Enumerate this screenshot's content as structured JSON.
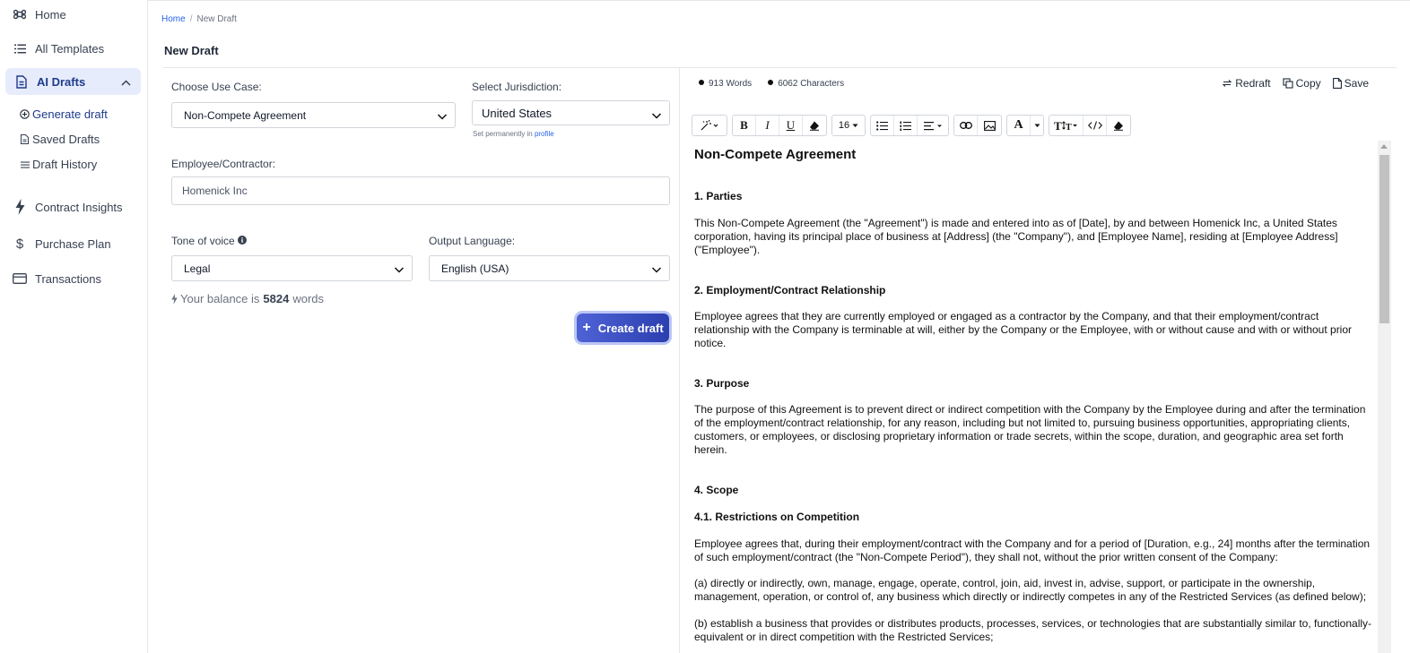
{
  "sidebar": {
    "items": [
      {
        "label": "Home",
        "icon": "command-icon"
      },
      {
        "label": "All Templates",
        "icon": "list-icon"
      },
      {
        "label": "AI Drafts",
        "icon": "document-icon"
      },
      {
        "label": "Contract Insights",
        "icon": "lightning-icon"
      },
      {
        "label": "Purchase Plan",
        "icon": "dollar-icon"
      },
      {
        "label": "Transactions",
        "icon": "card-icon"
      }
    ],
    "sub_items": [
      {
        "label": "Generate draft",
        "icon": "plus-circle-icon"
      },
      {
        "label": "Saved Drafts",
        "icon": "file-icon"
      },
      {
        "label": "Draft History",
        "icon": "lines-icon"
      }
    ]
  },
  "breadcrumb": {
    "home": "Home",
    "separator": "/",
    "current": "New Draft"
  },
  "page_title": "New Draft",
  "form": {
    "use_case_label": "Choose Use Case:",
    "use_case_value": "Non-Compete Agreement",
    "jurisdiction_label": "Select Jurisdiction:",
    "jurisdiction_value": "United States",
    "jurisdiction_hint": "Set permanently in",
    "jurisdiction_hint_link": "profile",
    "employee_label": "Employee/Contractor:",
    "employee_value": "Homenick Inc",
    "tone_label": "Tone of voice",
    "tone_value": "Legal",
    "language_label": "Output Language:",
    "language_value": "English (USA)",
    "balance_prefix": "Your balance is",
    "balance_value": "5824",
    "balance_suffix": "words",
    "create_label": "Create draft"
  },
  "editor": {
    "words": "913 Words",
    "characters": "6062 Characters",
    "redraft": "Redraft",
    "copy": "Copy",
    "save": "Save",
    "font_size": "16"
  },
  "document": {
    "title": "Non-Compete Agreement",
    "s1_heading": "1. Parties",
    "s1_text": "This Non-Compete Agreement (the \"Agreement\") is made and entered into as of [Date], by and between Homenick Inc, a United States corporation, having its principal place of business at [Address] (the \"Company\"), and [Employee Name], residing at [Employee Address] (\"Employee\").",
    "s2_heading": "2. Employment/Contract Relationship",
    "s2_text": "Employee agrees that they are currently employed or engaged as a contractor by the Company, and that their employment/contract relationship with the Company is terminable at will, either by the Company or the Employee, with or without cause and with or without prior notice.",
    "s3_heading": "3. Purpose",
    "s3_text": "The purpose of this Agreement is to prevent direct or indirect competition with the Company by the Employee during and after the termination of the employment/contract relationship, for any reason, including but not limited to, pursuing business opportunities, appropriating clients, customers, or employees, or disclosing proprietary information or trade secrets, within the scope, duration, and geographic area set forth herein.",
    "s4_heading": "4. Scope",
    "s41_heading": "4.1. Restrictions on Competition",
    "s41_text": "Employee agrees that, during their employment/contract with the Company and for a period of [Duration, e.g., 24] months after the termination of such employment/contract (the \"Non-Compete Period\"), they shall not, without the prior written consent of the Company:",
    "s41_a": "(a) directly or indirectly, own, manage, engage, operate, control, join, aid, invest in, advise, support, or participate in the ownership, management, operation, or control of, any business which directly or indirectly competes in any of the Restricted Services (as defined below);",
    "s41_b": "(b) establish a business that provides or distributes products, processes, services, or technologies that are substantially similar to, functionally-equivalent or in direct competition with the Restricted Services;"
  }
}
